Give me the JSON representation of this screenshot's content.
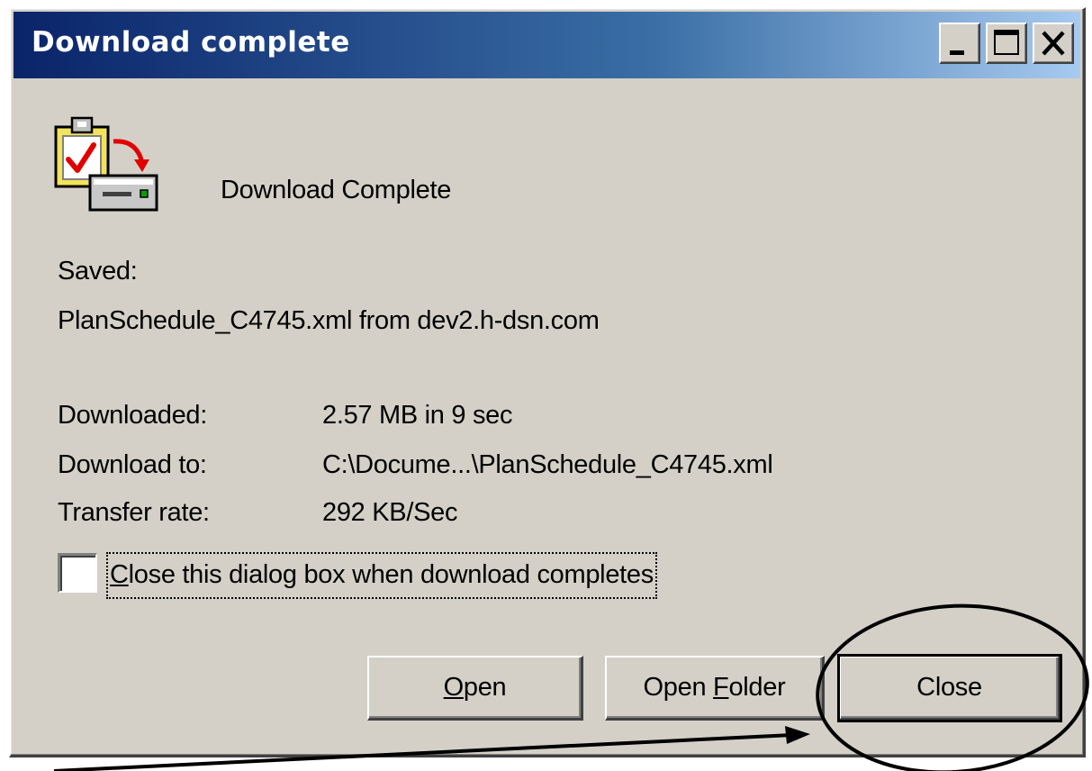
{
  "window": {
    "title": "Download complete"
  },
  "content": {
    "heading": "Download Complete",
    "saved_label": "Saved:",
    "saved_file": "PlanSchedule_C4745.xml from dev2.h-dsn.com",
    "details": [
      {
        "label": "Downloaded:",
        "value": "2.57 MB in 9 sec"
      },
      {
        "label": "Download to:",
        "value": "C:\\Docume...\\PlanSchedule_C4745.xml"
      },
      {
        "label": "Transfer rate:",
        "value": "292 KB/Sec"
      }
    ],
    "close_checkbox": {
      "mnemonic": "C",
      "rest": "lose this dialog box when download completes",
      "checked": false
    }
  },
  "buttons": {
    "open": {
      "mnemonic": "O",
      "rest": "pen"
    },
    "open_folder": {
      "prefix": "Open ",
      "mnemonic": "F",
      "rest": "older"
    },
    "close": {
      "label": "Close"
    }
  },
  "colors": {
    "dialog_bg": "#d4d0c8",
    "title_start": "#0a246a",
    "title_end": "#a6caf0",
    "annotation": "#000000"
  },
  "icons": {
    "download_complete": "download-complete-icon",
    "minimize": "minimize-icon",
    "maximize": "maximize-icon",
    "close": "close-icon"
  }
}
